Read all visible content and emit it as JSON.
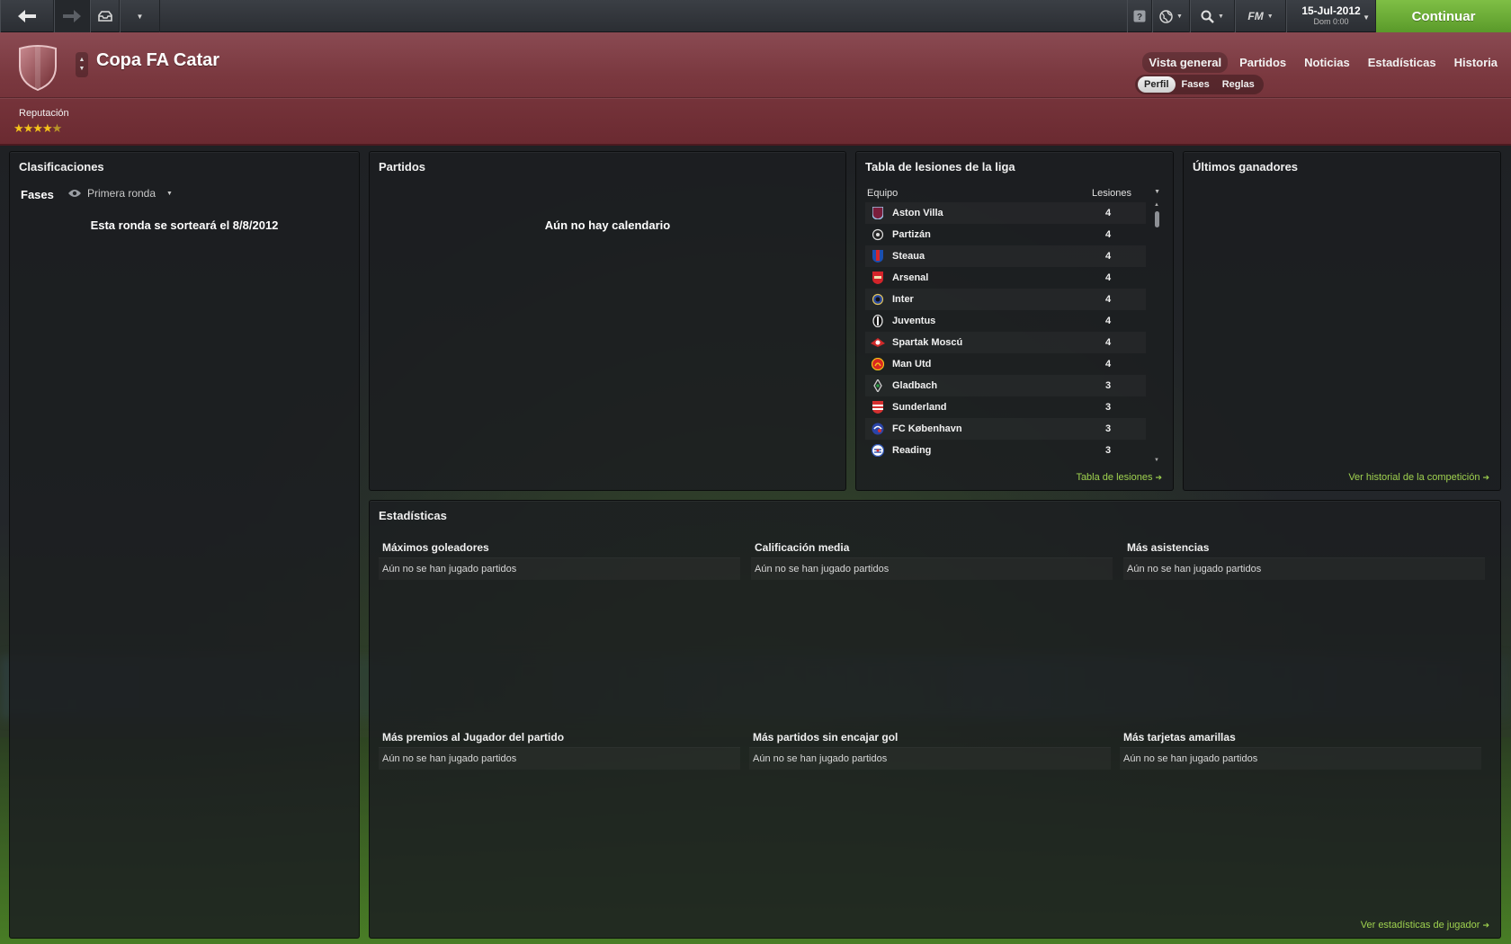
{
  "topbar": {
    "date": "15-Jul-2012",
    "day_time": "Dom 0:00",
    "fm_label": "FM",
    "continue_label": "Continuar"
  },
  "header": {
    "title": "Copa FA Catar",
    "main_tabs": [
      "Vista general",
      "Partidos",
      "Noticias",
      "Estadísticas",
      "Historia"
    ],
    "active_main_tab": "Vista general",
    "sub_tabs": [
      "Perfil",
      "Fases",
      "Reglas"
    ],
    "active_sub_tab": "Perfil",
    "reputation_label": "Reputación",
    "reputation_stars": 4.5,
    "reputation_display": "★★★★★"
  },
  "clasificaciones": {
    "title": "Clasificaciones",
    "fases_label": "Fases",
    "round_value": "Primera ronda",
    "round_info": "Esta ronda se sorteará el 8/8/2012"
  },
  "partidos": {
    "title": "Partidos",
    "empty_message": "Aún no hay calendario"
  },
  "injuries": {
    "title": "Tabla de lesiones de la liga",
    "col_team": "Equipo",
    "col_count": "Lesiones",
    "rows": [
      {
        "team": "Aston Villa",
        "count": "4",
        "color": "#7a1e3c"
      },
      {
        "team": "Partizán",
        "count": "4",
        "color": "#dddddd"
      },
      {
        "team": "Steaua",
        "count": "4",
        "color": "#1b4fb0"
      },
      {
        "team": "Arsenal",
        "count": "4",
        "color": "#d3242a"
      },
      {
        "team": "Inter",
        "count": "4",
        "color": "#2a4aa0"
      },
      {
        "team": "Juventus",
        "count": "4",
        "color": "#eeeeee"
      },
      {
        "team": "Spartak Moscú",
        "count": "4",
        "color": "#cf2a2a"
      },
      {
        "team": "Man Utd",
        "count": "4",
        "color": "#d8271f"
      },
      {
        "team": "Gladbach",
        "count": "3",
        "color": "#cccccc"
      },
      {
        "team": "Sunderland",
        "count": "3",
        "color": "#d43030"
      },
      {
        "team": "FC København",
        "count": "3",
        "color": "#2a44a8"
      },
      {
        "team": "Reading",
        "count": "3",
        "color": "#3358b5"
      }
    ],
    "link": "Tabla de lesiones"
  },
  "winners": {
    "title": "Últimos ganadores",
    "link": "Ver historial de la competición"
  },
  "stats": {
    "title": "Estadísticas",
    "empty": "Aún no se han jugado partidos",
    "blocks": [
      {
        "title": "Máximos goleadores"
      },
      {
        "title": "Calificación media"
      },
      {
        "title": "Más asistencias"
      },
      {
        "title": "Más premios al Jugador del partido"
      },
      {
        "title": "Más partidos sin encajar gol"
      },
      {
        "title": "Más tarjetas amarillas"
      }
    ],
    "link": "Ver estadísticas de jugador"
  },
  "colors": {
    "header_red": "#7a383f",
    "accent_green": "#7fbf45",
    "link_green": "#9fd24f",
    "star_gold": "#f4c21a"
  }
}
